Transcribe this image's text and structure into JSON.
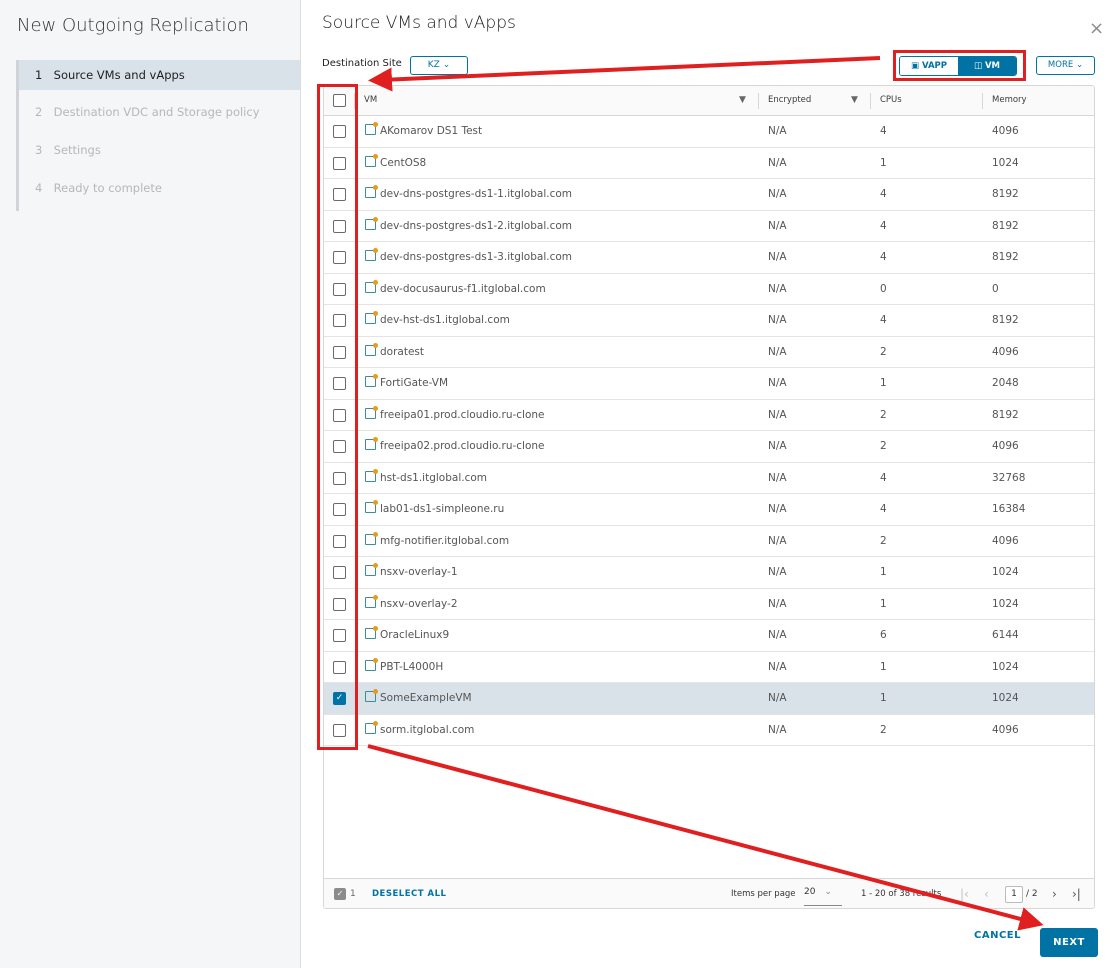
{
  "wizard": {
    "title": "New Outgoing Replication",
    "steps": [
      {
        "num": "1",
        "label": "Source VMs and vApps"
      },
      {
        "num": "2",
        "label": "Destination VDC and Storage policy"
      },
      {
        "num": "3",
        "label": "Settings"
      },
      {
        "num": "4",
        "label": "Ready to complete"
      }
    ]
  },
  "main": {
    "title": "Source VMs and vApps",
    "close": "×",
    "destination_label": "Destination Site",
    "destination_value": "KZ",
    "toggle": {
      "vapp": "VAPP",
      "vm": "VM",
      "selected": "VM"
    },
    "more_label": "MORE"
  },
  "grid": {
    "columns": [
      "VM",
      "Encrypted",
      "CPUs",
      "Memory"
    ],
    "rows": [
      {
        "vm": "AKomarov DS1 Test",
        "encrypted": "N/A",
        "cpus": "4",
        "memory": "4096",
        "checked": false
      },
      {
        "vm": "CentOS8",
        "encrypted": "N/A",
        "cpus": "1",
        "memory": "1024",
        "checked": false
      },
      {
        "vm": "dev-dns-postgres-ds1-1.itglobal.com",
        "encrypted": "N/A",
        "cpus": "4",
        "memory": "8192",
        "checked": false
      },
      {
        "vm": "dev-dns-postgres-ds1-2.itglobal.com",
        "encrypted": "N/A",
        "cpus": "4",
        "memory": "8192",
        "checked": false
      },
      {
        "vm": "dev-dns-postgres-ds1-3.itglobal.com",
        "encrypted": "N/A",
        "cpus": "4",
        "memory": "8192",
        "checked": false
      },
      {
        "vm": "dev-docusaurus-f1.itglobal.com",
        "encrypted": "N/A",
        "cpus": "0",
        "memory": "0",
        "checked": false
      },
      {
        "vm": "dev-hst-ds1.itglobal.com",
        "encrypted": "N/A",
        "cpus": "4",
        "memory": "8192",
        "checked": false
      },
      {
        "vm": "doratest",
        "encrypted": "N/A",
        "cpus": "2",
        "memory": "4096",
        "checked": false
      },
      {
        "vm": "FortiGate-VM",
        "encrypted": "N/A",
        "cpus": "1",
        "memory": "2048",
        "checked": false
      },
      {
        "vm": "freeipa01.prod.cloudio.ru-clone",
        "encrypted": "N/A",
        "cpus": "2",
        "memory": "8192",
        "checked": false
      },
      {
        "vm": "freeipa02.prod.cloudio.ru-clone",
        "encrypted": "N/A",
        "cpus": "2",
        "memory": "4096",
        "checked": false
      },
      {
        "vm": "hst-ds1.itglobal.com",
        "encrypted": "N/A",
        "cpus": "4",
        "memory": "32768",
        "checked": false
      },
      {
        "vm": "lab01-ds1-simpleone.ru",
        "encrypted": "N/A",
        "cpus": "4",
        "memory": "16384",
        "checked": false
      },
      {
        "vm": "mfg-notifier.itglobal.com",
        "encrypted": "N/A",
        "cpus": "2",
        "memory": "4096",
        "checked": false
      },
      {
        "vm": "nsxv-overlay-1",
        "encrypted": "N/A",
        "cpus": "1",
        "memory": "1024",
        "checked": false
      },
      {
        "vm": "nsxv-overlay-2",
        "encrypted": "N/A",
        "cpus": "1",
        "memory": "1024",
        "checked": false
      },
      {
        "vm": "OracleLinux9",
        "encrypted": "N/A",
        "cpus": "6",
        "memory": "6144",
        "checked": false
      },
      {
        "vm": "PBT-L4000H",
        "encrypted": "N/A",
        "cpus": "1",
        "memory": "1024",
        "checked": false
      },
      {
        "vm": "SomeExampleVM",
        "encrypted": "N/A",
        "cpus": "1",
        "memory": "1024",
        "checked": true
      },
      {
        "vm": "sorm.itglobal.com",
        "encrypted": "N/A",
        "cpus": "2",
        "memory": "4096",
        "checked": false
      }
    ],
    "footer": {
      "selected_count": "1",
      "deselect_all": "DESELECT ALL",
      "items_per_page_label": "Items per page",
      "items_per_page": "20",
      "range_text": "1 - 20 of 38 results",
      "current_page": "1",
      "total_pages": "/ 2"
    }
  },
  "actions": {
    "cancel": "CANCEL",
    "next": "NEXT"
  },
  "colors": {
    "accent": "#0072a3",
    "annotation": "#e02020",
    "selected_row": "#d9e2e9"
  }
}
